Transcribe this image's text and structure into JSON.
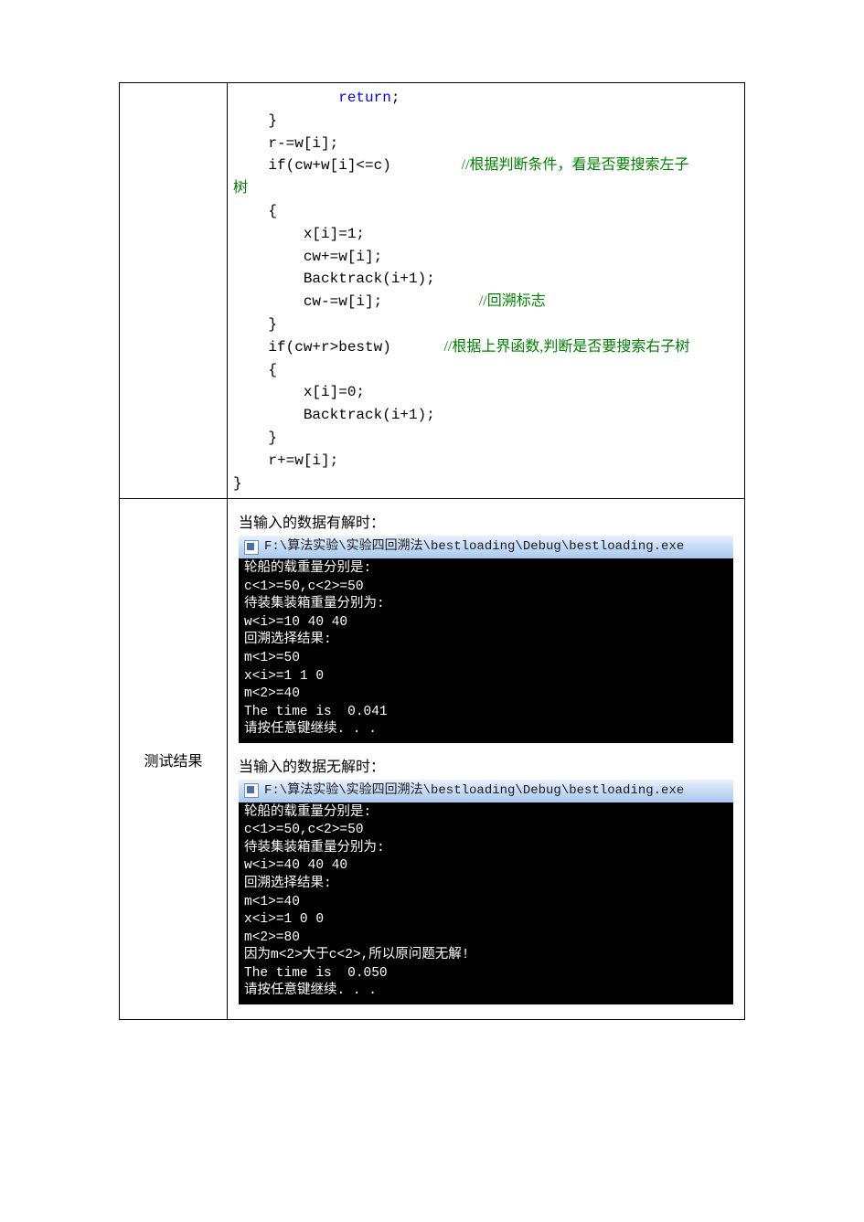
{
  "code": {
    "l1": "            return;",
    "l2": "    }",
    "l3a": "    r-=w[i];",
    "l4a": "    if(cw+w[i]<=c)        ",
    "l4b": "//根据判断条件，看是否要搜索左子",
    "l4c": "树",
    "l5": "    {",
    "l6": "        x[i]=1;",
    "l7": "        cw+=w[i];",
    "l8": "        Backtrack(i+1);",
    "l9a": "        cw-=w[i];           ",
    "l9b": "//回溯标志",
    "l10": "    }",
    "l11a": "    if(cw+r>bestw)      ",
    "l11b": "//根据上界函数,判断是否要搜索右子树",
    "l12": "    {",
    "l13": "        x[i]=0;",
    "l14": "        Backtrack(i+1);",
    "l15": "    }",
    "l16": "    r+=w[i];",
    "l17": "}"
  },
  "results": {
    "label": "测试结果",
    "intro_ok": "当输入的数据有解时：",
    "intro_no": "当输入的数据无解时：",
    "titlebar": "F:\\算法实验\\实验四回溯法\\bestloading\\Debug\\bestloading.exe",
    "console_ok": "轮船的载重量分别是:\nc<1>=50,c<2>=50\n待装集装箱重量分别为:\nw<i>=10 40 40\n回溯选择结果:\nm<1>=50\nx<i>=1 1 0\nm<2>=40\nThe time is  0.041\n请按任意键继续. . .",
    "console_no": "轮船的载重量分别是:\nc<1>=50,c<2>=50\n待装集装箱重量分别为:\nw<i>=40 40 40\n回溯选择结果:\nm<1>=40\nx<i>=1 0 0\nm<2>=80\n因为m<2>大于c<2>,所以原问题无解!\nThe time is  0.050\n请按任意键继续. . ."
  }
}
